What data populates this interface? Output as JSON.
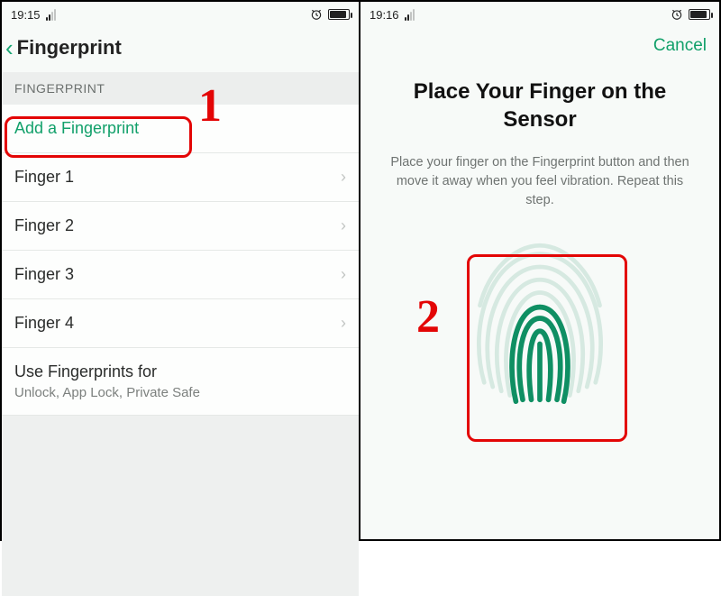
{
  "left": {
    "status": {
      "time": "19:15"
    },
    "header": {
      "title": "Fingerprint"
    },
    "section_label": "FINGERPRINT",
    "rows": {
      "add": "Add a Fingerprint",
      "finger1": "Finger 1",
      "finger2": "Finger 2",
      "finger3": "Finger 3",
      "finger4": "Finger 4",
      "uses_title": "Use Fingerprints for",
      "uses_sub": "Unlock, App Lock, Private Safe"
    }
  },
  "right": {
    "status": {
      "time": "19:16"
    },
    "cancel": "Cancel",
    "title": "Place Your Finger on the Sensor",
    "subtitle": "Place your finger on the Fingerprint button and then move it away when you feel vibration. Repeat this step."
  },
  "annotations": {
    "step1": "1",
    "step2": "2"
  }
}
